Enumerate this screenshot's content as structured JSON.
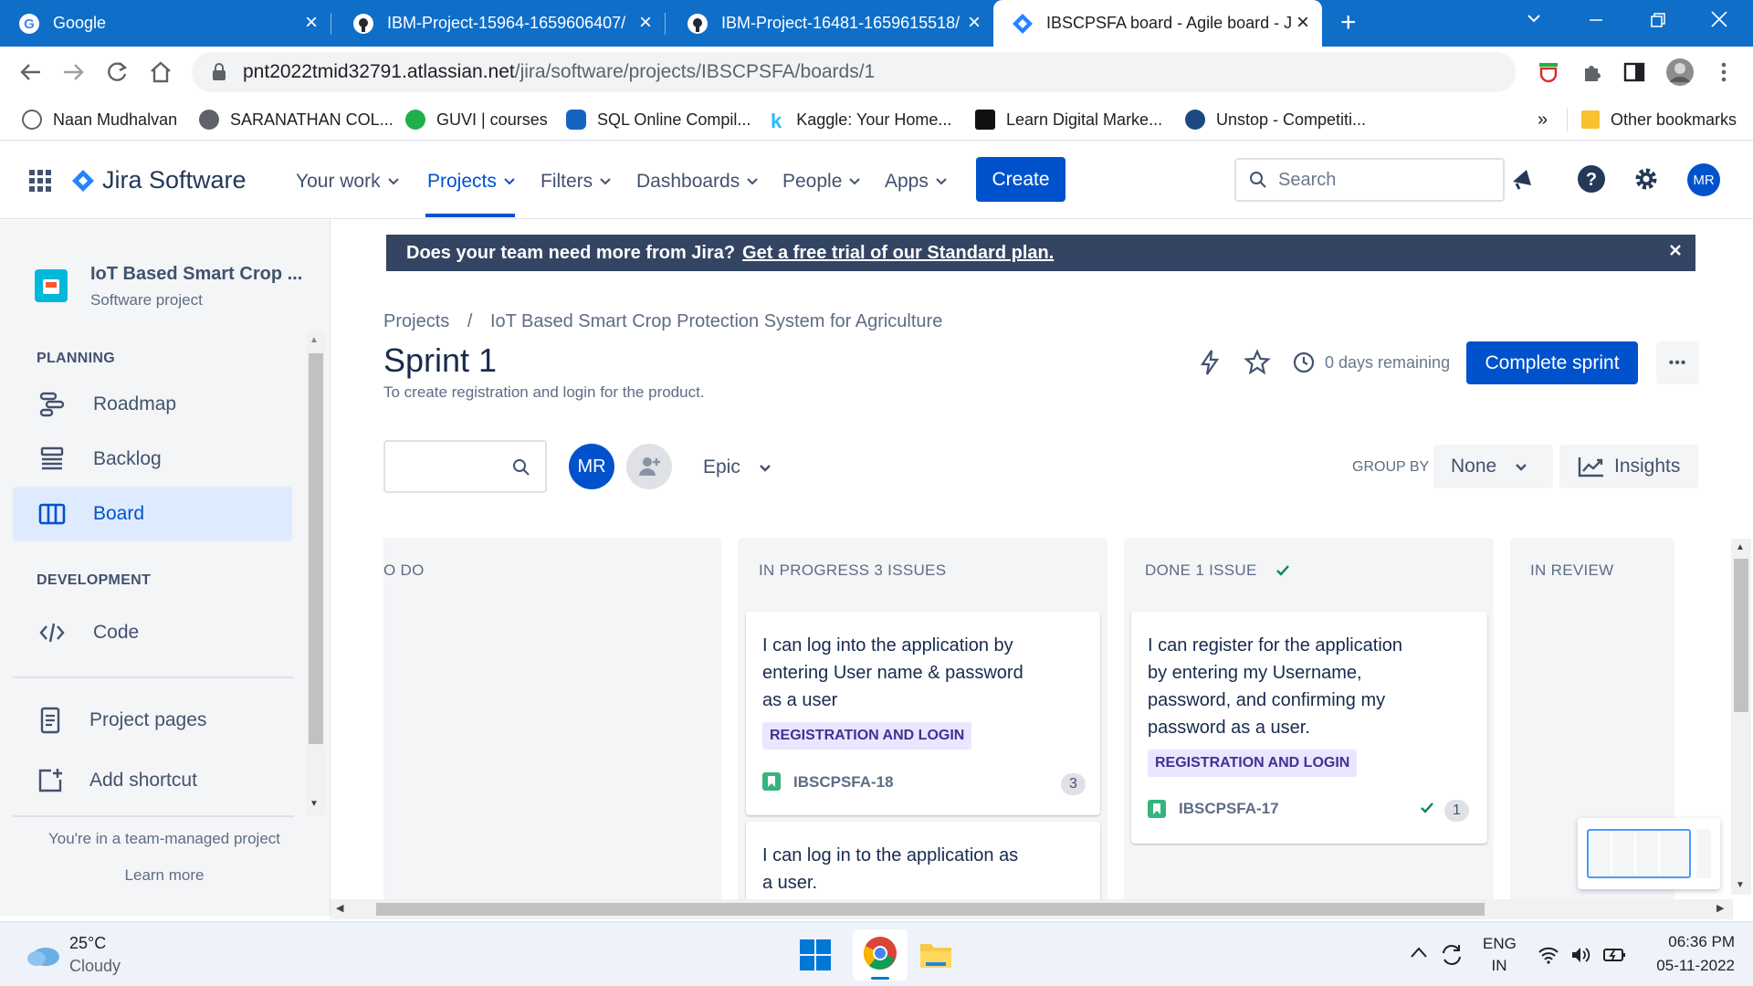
{
  "browser": {
    "tabs": [
      {
        "title": "Google",
        "icon": "google-icon"
      },
      {
        "title": "IBM-Project-15964-1659606407/",
        "icon": "github-icon"
      },
      {
        "title": "IBM-Project-16481-1659615518/",
        "icon": "github-icon"
      },
      {
        "title": "IBSCPSFA board - Agile board - J",
        "icon": "jira-icon"
      }
    ],
    "url_host": "pnt2022tmid32791.atlassian.net",
    "url_path": "/jira/software/projects/IBSCPSFA/boards/1",
    "bookmarks": [
      {
        "label": "Naan Mudhalvan",
        "color": "#5f6368"
      },
      {
        "label": "SARANATHAN COL...",
        "color": "#5f6368"
      },
      {
        "label": "GUVI | courses",
        "color": "#20b04b"
      },
      {
        "label": "SQL Online Compil...",
        "color": "#1565c0"
      },
      {
        "label": "Kaggle: Your Home...",
        "color": "#20beff"
      },
      {
        "label": "Learn Digital Marke...",
        "color": "#111111"
      },
      {
        "label": "Unstop - Competiti...",
        "color": "#1c4980"
      }
    ],
    "bookmarks_more": "»",
    "other_bookmarks": "Other bookmarks"
  },
  "jira": {
    "product": "Jira Software",
    "nav": [
      "Your work",
      "Projects",
      "Filters",
      "Dashboards",
      "People",
      "Apps"
    ],
    "create": "Create",
    "search_placeholder": "Search",
    "avatar": "MR"
  },
  "sidebar": {
    "project_name": "IoT Based Smart Crop ...",
    "project_type": "Software project",
    "planning_header": "PLANNING",
    "planning": [
      {
        "label": "Roadmap",
        "icon": "roadmap-icon"
      },
      {
        "label": "Backlog",
        "icon": "backlog-icon"
      },
      {
        "label": "Board",
        "icon": "board-icon",
        "active": true
      }
    ],
    "development_header": "DEVELOPMENT",
    "code": "Code",
    "project_pages": "Project pages",
    "add_shortcut": "Add shortcut",
    "team_managed": "You're in a team-managed project",
    "learn_more": "Learn more"
  },
  "banner": {
    "text": "Does your team need more from Jira?",
    "link": "Get a free trial of our Standard plan."
  },
  "board": {
    "breadcrumb_projects": "Projects",
    "breadcrumb_sep": "/",
    "breadcrumb_project": "IoT Based Smart Crop Protection System for Agriculture",
    "sprint_title": "Sprint 1",
    "sprint_goal": "To create registration and login for the product.",
    "days_remaining": "0 days remaining",
    "complete_sprint": "Complete sprint",
    "more": "•••",
    "avatar": "MR",
    "epic_filter": "Epic",
    "group_by_label": "GROUP BY",
    "group_by_value": "None",
    "insights": "Insights",
    "columns": [
      {
        "title": "O DO"
      },
      {
        "title": "IN PROGRESS 3 ISSUES"
      },
      {
        "title": "DONE 1 ISSUE"
      },
      {
        "title": "IN REVIEW"
      }
    ],
    "cards": [
      {
        "summary_lines": [
          "I can log into the application by",
          "entering User name & password",
          "as a user"
        ],
        "epic": "REGISTRATION AND LOGIN",
        "key": "IBSCPSFA-18",
        "count": "3"
      },
      {
        "summary_lines": [
          "I can log in to the application as",
          "a user."
        ]
      },
      {
        "summary_lines": [
          "I can register for the application",
          "by entering my Username,",
          "password, and confirming my",
          "password as a user."
        ],
        "epic": "REGISTRATION AND LOGIN",
        "key": "IBSCPSFA-17",
        "count": "1"
      }
    ]
  },
  "taskbar": {
    "temp": "25°C",
    "weather": "Cloudy",
    "lang1": "ENG",
    "lang2": "IN",
    "time": "06:36 PM",
    "date": "05-11-2022"
  }
}
